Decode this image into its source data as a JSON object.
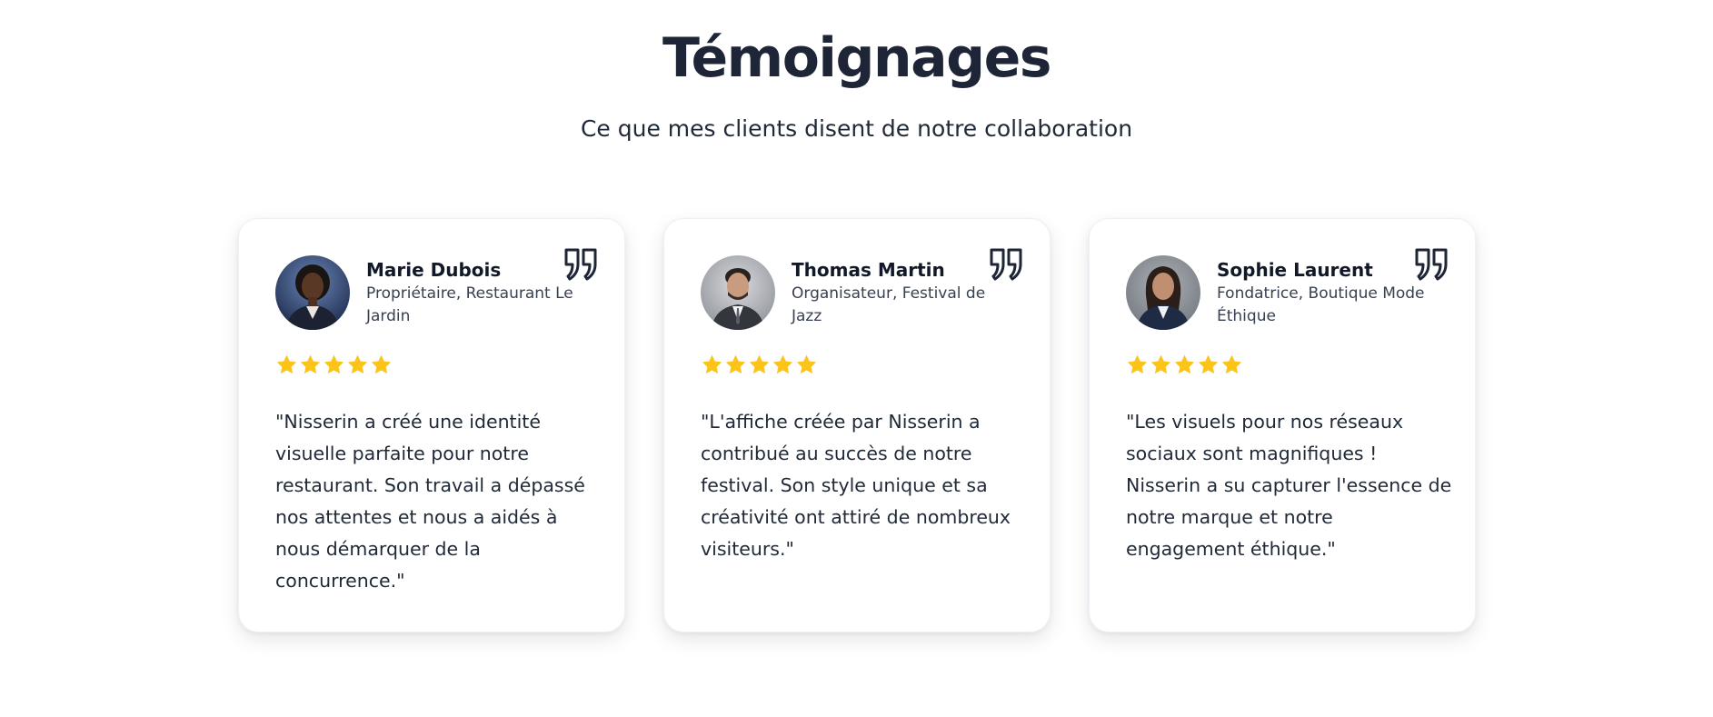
{
  "section": {
    "title": "Témoignages",
    "subtitle": "Ce que mes clients disent de notre collaboration"
  },
  "colors": {
    "title": "#1e2537",
    "star": "#fcc419",
    "quote_icon": "#1e2537"
  },
  "testimonials": [
    {
      "name": "Marie Dubois",
      "role": "Propriétaire, Restaurant Le Jardin",
      "rating": 5,
      "text": "\"Nisserin a créé une identité visuelle parfaite pour notre restaurant. Son travail a dépassé nos attentes et nous a aidés à nous démarquer de la concurrence.\""
    },
    {
      "name": "Thomas Martin",
      "role": "Organisateur, Festival de Jazz",
      "rating": 5,
      "text": "\"L'affiche créée par Nisserin a contribué au succès de notre festival. Son style unique et sa créativité ont attiré de nombreux visiteurs.\""
    },
    {
      "name": "Sophie Laurent",
      "role": "Fondatrice, Boutique Mode Éthique",
      "rating": 5,
      "text": "\"Les visuels pour nos réseaux sociaux sont magnifiques ! Nisserin a su capturer l'essence de notre marque et notre engagement éthique.\""
    }
  ]
}
